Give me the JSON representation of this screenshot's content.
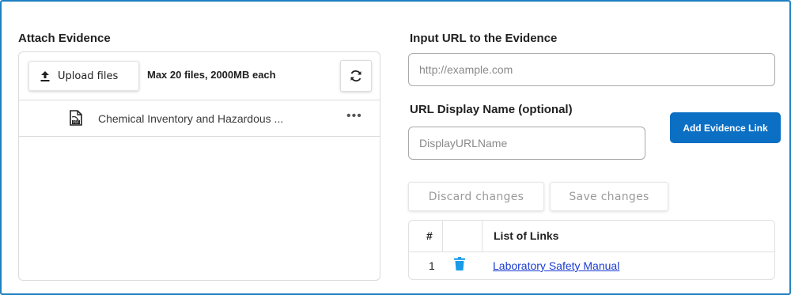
{
  "attach": {
    "title": "Attach Evidence",
    "upload_label": "Upload files",
    "limits": "Max 20 files, 2000MB each",
    "files": [
      {
        "name": "Chemical Inventory and Hazardous ...",
        "type_icon": "pdf-file-icon"
      }
    ],
    "more_glyph": "•••"
  },
  "url_section": {
    "title": "Input URL to the Evidence",
    "url_placeholder": "http://example.com",
    "name_title": "URL Display Name (optional)",
    "name_placeholder": "DisplayURLName",
    "add_button": "Add Evidence Link",
    "discard_button": "Discard changes",
    "save_button": "Save changes"
  },
  "links_table": {
    "col_number": "#",
    "col_links": "List of Links",
    "rows": [
      {
        "number": "1",
        "link": "Laboratory Safety Manual"
      }
    ]
  },
  "colors": {
    "frame_border": "#1f7fc1",
    "primary_button": "#0b6fc4",
    "trash_icon": "#1a9be8",
    "link": "#1a3bd1"
  },
  "icons": {
    "upload": "upload-arrow-icon",
    "refresh": "refresh-icon",
    "file": "pdf-file-icon",
    "more": "more-horizontal-icon",
    "delete": "trash-icon"
  }
}
